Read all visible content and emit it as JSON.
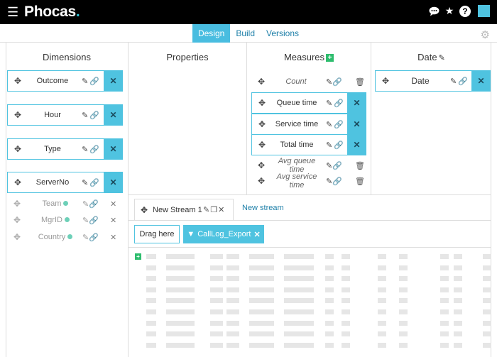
{
  "app": {
    "name": "Phocas",
    "menu_icon": "hamburger-icon"
  },
  "top_icons": [
    "chat-icon",
    "star-icon",
    "help-icon",
    "color-swatch-icon"
  ],
  "tabs": [
    {
      "label": "Design",
      "active": true
    },
    {
      "label": "Build"
    },
    {
      "label": "Versions"
    }
  ],
  "columns": {
    "dimensions": "Dimensions",
    "properties": "Properties",
    "measures": "Measures",
    "date": "Date"
  },
  "dimensions_active": [
    {
      "label": "Outcome"
    },
    {
      "label": "Hour"
    },
    {
      "label": "Type"
    },
    {
      "label": "ServerNo"
    }
  ],
  "dimensions_inactive": [
    {
      "label": "Team"
    },
    {
      "label": "MgrID"
    },
    {
      "label": "Country"
    }
  ],
  "measures": [
    {
      "label": "Count",
      "active": false
    },
    {
      "label": "Queue time",
      "active": true
    },
    {
      "label": "Service time",
      "active": true
    },
    {
      "label": "Total time",
      "active": true
    },
    {
      "label": "Avg queue time",
      "active": false
    },
    {
      "label": "Avg service time",
      "active": false
    }
  ],
  "date_items": [
    {
      "label": "Date"
    }
  ],
  "stream": {
    "tab_label": "New Stream 1",
    "new_stream": "New stream",
    "drag_here": "Drag here",
    "filter_label": "CallLog_Export"
  },
  "colors": {
    "accent": "#4fc3e0",
    "link": "#1d7fa8",
    "green": "#2ebd6e"
  }
}
